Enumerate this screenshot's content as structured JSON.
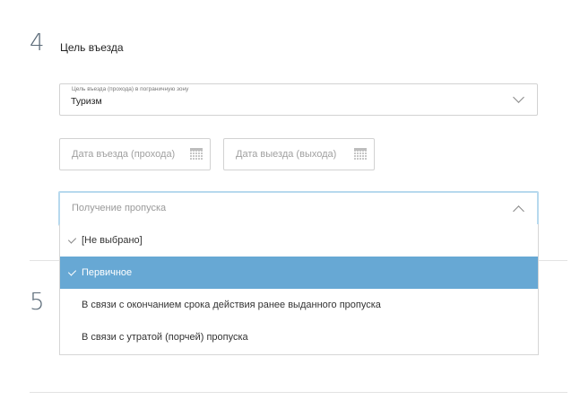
{
  "steps": {
    "step4_number": "4",
    "step5_number": "5",
    "step4_title": "Цель въезда"
  },
  "purpose_select": {
    "label": "Цель въезда (прохода) в пограничную зону",
    "value": "Туризм"
  },
  "dates": {
    "entry_placeholder": "Дата въезда (прохода)",
    "exit_placeholder": "Дата выезда (выхода)"
  },
  "pass_select": {
    "placeholder": "Получение пропуска",
    "options": [
      {
        "label": "[Не выбрано]",
        "checked": true,
        "highlighted": false
      },
      {
        "label": "Первичное",
        "checked": true,
        "highlighted": true
      },
      {
        "label": "В связи с окончанием срока действия ранее выданного пропуска",
        "checked": false,
        "highlighted": false
      },
      {
        "label": "В связи с утратой (порчей) пропуска",
        "checked": false,
        "highlighted": false
      }
    ]
  },
  "colors": {
    "highlight": "#67a8d4",
    "focus_border": "#b7d9ee"
  }
}
